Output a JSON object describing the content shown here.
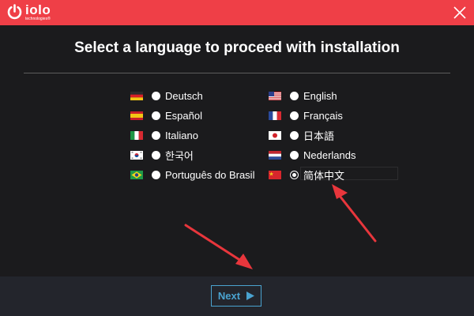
{
  "app": {
    "logo_text": "iolo",
    "logo_subtext": "technologies®"
  },
  "icons": {
    "logo": "power-icon",
    "close": "close-icon",
    "next": "play-arrow-icon"
  },
  "heading": "Select a language to proceed with installation",
  "languages": [
    {
      "label": "Deutsch",
      "flag": "de",
      "selected": false
    },
    {
      "label": "English",
      "flag": "us",
      "selected": false
    },
    {
      "label": "Español",
      "flag": "es",
      "selected": false
    },
    {
      "label": "Français",
      "flag": "fr",
      "selected": false
    },
    {
      "label": "Italiano",
      "flag": "it",
      "selected": false
    },
    {
      "label": "日本語",
      "flag": "jp",
      "selected": false
    },
    {
      "label": "한국어",
      "flag": "kr",
      "selected": false
    },
    {
      "label": "Nederlands",
      "flag": "nl",
      "selected": false
    },
    {
      "label": "Português do Brasil",
      "flag": "br",
      "selected": false
    },
    {
      "label": "简体中文",
      "flag": "cn",
      "selected": true
    }
  ],
  "footer": {
    "next_label": "Next"
  },
  "colors": {
    "titlebar": "#ef3f47",
    "background": "#1b1b1d",
    "footer": "#23252c",
    "accent": "#4aa3d0",
    "annotation_arrow": "#e8363c"
  }
}
